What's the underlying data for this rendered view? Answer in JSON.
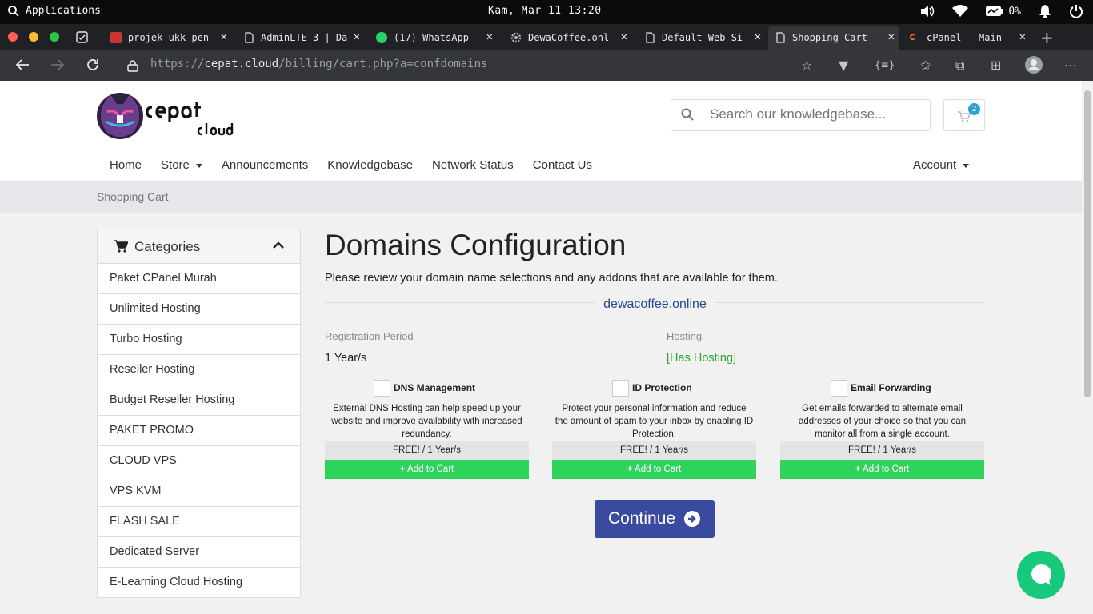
{
  "system_bar": {
    "apps_label": "Applications",
    "clock": "Kam, Mar 11   13:20",
    "battery": "0%"
  },
  "tabs": [
    {
      "label": "projek ukk pen",
      "icon": "app-icon",
      "active": false
    },
    {
      "label": "AdminLTE 3 | Da",
      "icon": "page-icon",
      "active": false
    },
    {
      "label": "(17) WhatsApp",
      "icon": "whatsapp-icon",
      "active": false
    },
    {
      "label": "DewaCoffee.onl",
      "icon": "gear-icon",
      "active": false
    },
    {
      "label": "Default Web Si",
      "icon": "page-icon",
      "active": false
    },
    {
      "label": "Shopping Cart",
      "icon": "page-icon",
      "active": true
    },
    {
      "label": "cPanel - Main",
      "icon": "cpanel-icon",
      "active": false
    }
  ],
  "address": {
    "scheme": "https://",
    "host": "cepat.cloud",
    "path": "/billing/cart.php?a=confdomains"
  },
  "header": {
    "search_placeholder": "Search our knowledgebase...",
    "cart_count": "2",
    "nav": [
      "Home",
      "Store",
      "Announcements",
      "Knowledgebase",
      "Network Status",
      "Contact Us"
    ],
    "account": "Account"
  },
  "breadcrumb": "Shopping Cart",
  "sidebar": {
    "title": "Categories",
    "items": [
      "Paket CPanel Murah",
      "Unlimited Hosting",
      "Turbo Hosting",
      "Reseller Hosting",
      "Budget Reseller Hosting",
      "PAKET PROMO",
      "CLOUD VPS",
      "VPS KVM",
      "FLASH SALE",
      "Dedicated Server",
      "E-Learning Cloud Hosting"
    ]
  },
  "main": {
    "title": "Domains Configuration",
    "intro": "Please review your domain name selections and any addons that are available for them.",
    "domain": "dewacoffee.online",
    "reg_label": "Registration Period",
    "reg_value": "1 Year/s",
    "hosting_label": "Hosting",
    "hosting_value": "[Has Hosting]",
    "addons": [
      {
        "name": "DNS Management",
        "desc": "External DNS Hosting can help speed up your website and improve availability with increased redundancy.",
        "price": "FREE! / 1 Year/s",
        "button": "Add to Cart"
      },
      {
        "name": "ID Protection",
        "desc": "Protect your personal information and reduce the amount of spam to your inbox by enabling ID Protection.",
        "price": "FREE! / 1 Year/s",
        "button": "Add to Cart"
      },
      {
        "name": "Email Forwarding",
        "desc": "Get emails forwarded to alternate email addresses of your choice so that you can monitor all from a single account.",
        "price": "FREE! / 1 Year/s",
        "button": "Add to Cart"
      }
    ],
    "continue": "Continue"
  },
  "colors": {
    "primary": "#3a4a9e",
    "add_to_cart": "#2ed35c",
    "hosting_green": "#2ba32b",
    "domain_link": "#264b8f",
    "chat": "#17c97a"
  }
}
